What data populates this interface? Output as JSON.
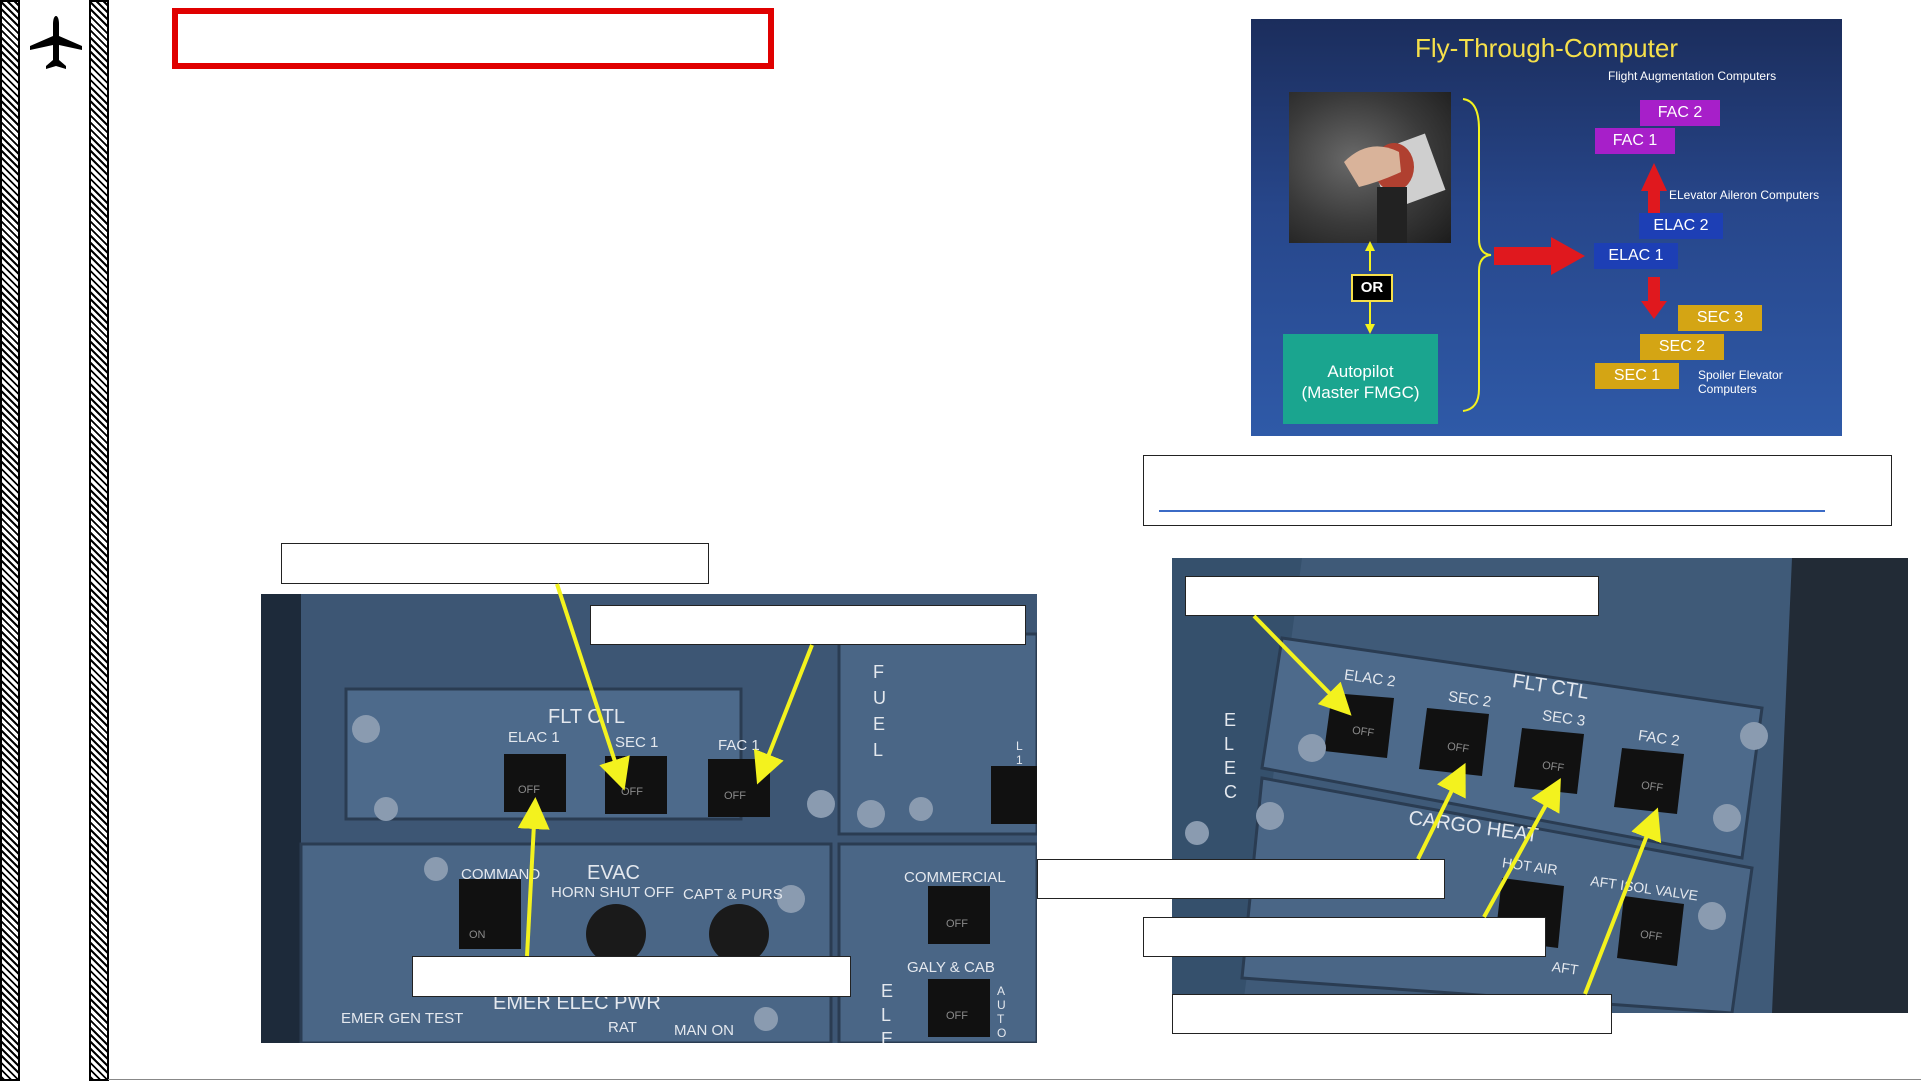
{
  "icons": {
    "rail_icon": "airplane-icon"
  },
  "diagram": {
    "title": "Fly-Through-Computer",
    "fac_group_label": "Flight Augmentation Computers",
    "elac_group_label": "ELevator Aileron Computers",
    "sec_group_label": "Spoiler Elevator Computers",
    "or_label": "OR",
    "autopilot_line1": "Autopilot",
    "autopilot_line2": "(Master FMGC)",
    "fac2": "FAC 2",
    "fac1": "FAC 1",
    "elac2": "ELAC 2",
    "elac1": "ELAC 1",
    "sec3": "SEC 3",
    "sec2": "SEC 2",
    "sec1": "SEC 1"
  },
  "overhead_left": {
    "panel_title": "FLT CTL",
    "buttons": [
      "ELAC 1",
      "SEC 1",
      "FAC 1"
    ],
    "switch_state": "OFF",
    "fuel_label": "F U E L",
    "evac": "EVAC",
    "command": "COMMAND",
    "horn": "HORN SHUT OFF",
    "capt": "CAPT & PURS",
    "commercial": "COMMERCIAL",
    "galy": "GALY & CAB",
    "emer_elec": "EMER ELEC PWR",
    "emer_gen": "EMER GEN TEST",
    "rat": "RAT",
    "man_on": "MAN ON",
    "on": "ON",
    "auto": "AUTO",
    "elec_letter": "E L E",
    "fuel_l1": "L 1"
  },
  "overhead_right": {
    "panel_title": "FLT CTL",
    "buttons": [
      "ELAC 2",
      "SEC 2",
      "SEC 3",
      "FAC 2"
    ],
    "switch_state": "OFF",
    "elec_label": "E L E C",
    "cargo_heat": "CARGO HEAT",
    "hot_air": "HOT AIR",
    "aft_isol": "AFT ISOL VALVE",
    "aft": "AFT"
  },
  "colors": {
    "title_box_border": "#e00000",
    "arrow": "#f3f21e",
    "panel": "#3f5a78",
    "fac": "#a71fc9",
    "elac": "#1d3fb5",
    "sec": "#d4a514",
    "autopilot": "#1aa58f"
  }
}
